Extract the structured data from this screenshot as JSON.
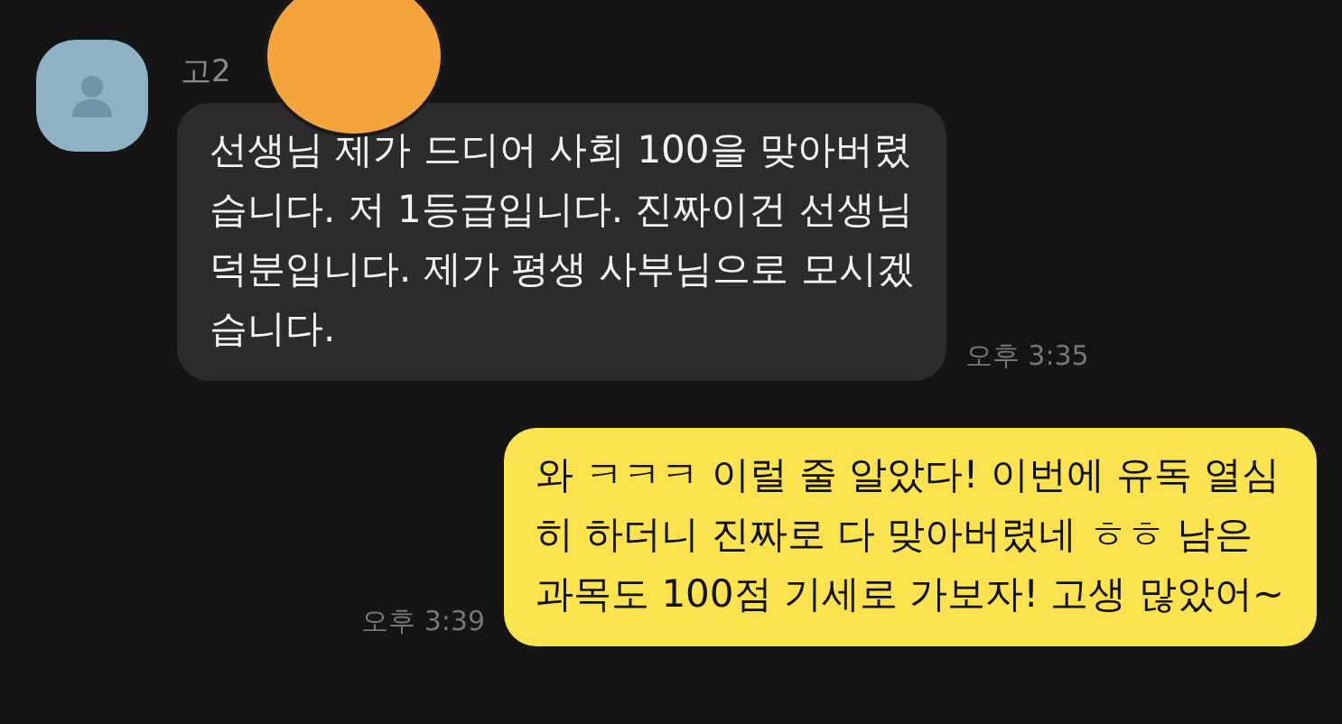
{
  "messages": [
    {
      "kind": "incoming",
      "sender": "고2",
      "text": "선생님 제가 드디어 사회 100을 맞아버렸\n습니다. 저 1등급입니다. 진짜이건 선생님\n덕분입니다. 제가 평생 사부님으로 모시겠\n습니다.",
      "time": "오후 3:35"
    },
    {
      "kind": "outgoing",
      "text": "와 ㅋㅋㅋ 이럴 줄 알았다! 이번에 유독 열심\n히 하더니 진짜로 다 맞아버렸네 ㅎㅎ 남은\n과목도 100점 기세로 가보자! 고생 많았어~",
      "time": "오후 3:39"
    }
  ]
}
